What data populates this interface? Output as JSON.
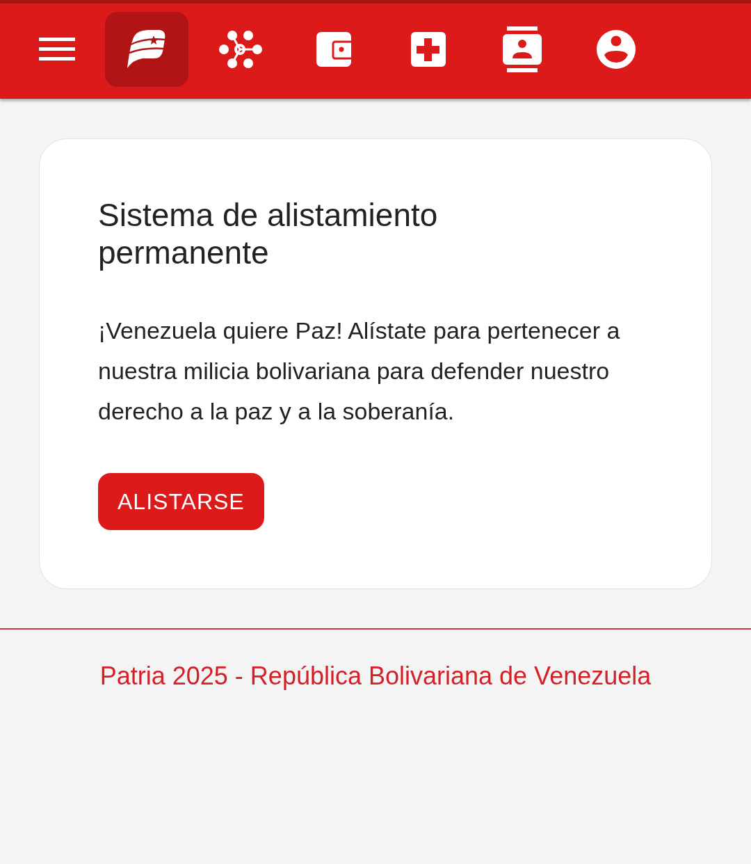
{
  "toolbar": {
    "items": [
      {
        "kind": "menu",
        "selected": false
      },
      {
        "kind": "logo",
        "selected": true
      },
      {
        "kind": "network",
        "selected": false
      },
      {
        "kind": "wallet",
        "selected": false
      },
      {
        "kind": "medical",
        "selected": false
      },
      {
        "kind": "contacts",
        "selected": false
      },
      {
        "kind": "account",
        "selected": false
      }
    ]
  },
  "card": {
    "title": "Sistema de alistamiento permanente",
    "text": "¡Venezuela quiere Paz! Alístate para pertenecer a nuestra milicia bolivariana para defender nuestro derecho a la paz y a la soberanía.",
    "button": "ALISTARSE"
  },
  "footer": {
    "text": "Patria 2025 - República Bolivariana de Venezuela"
  }
}
